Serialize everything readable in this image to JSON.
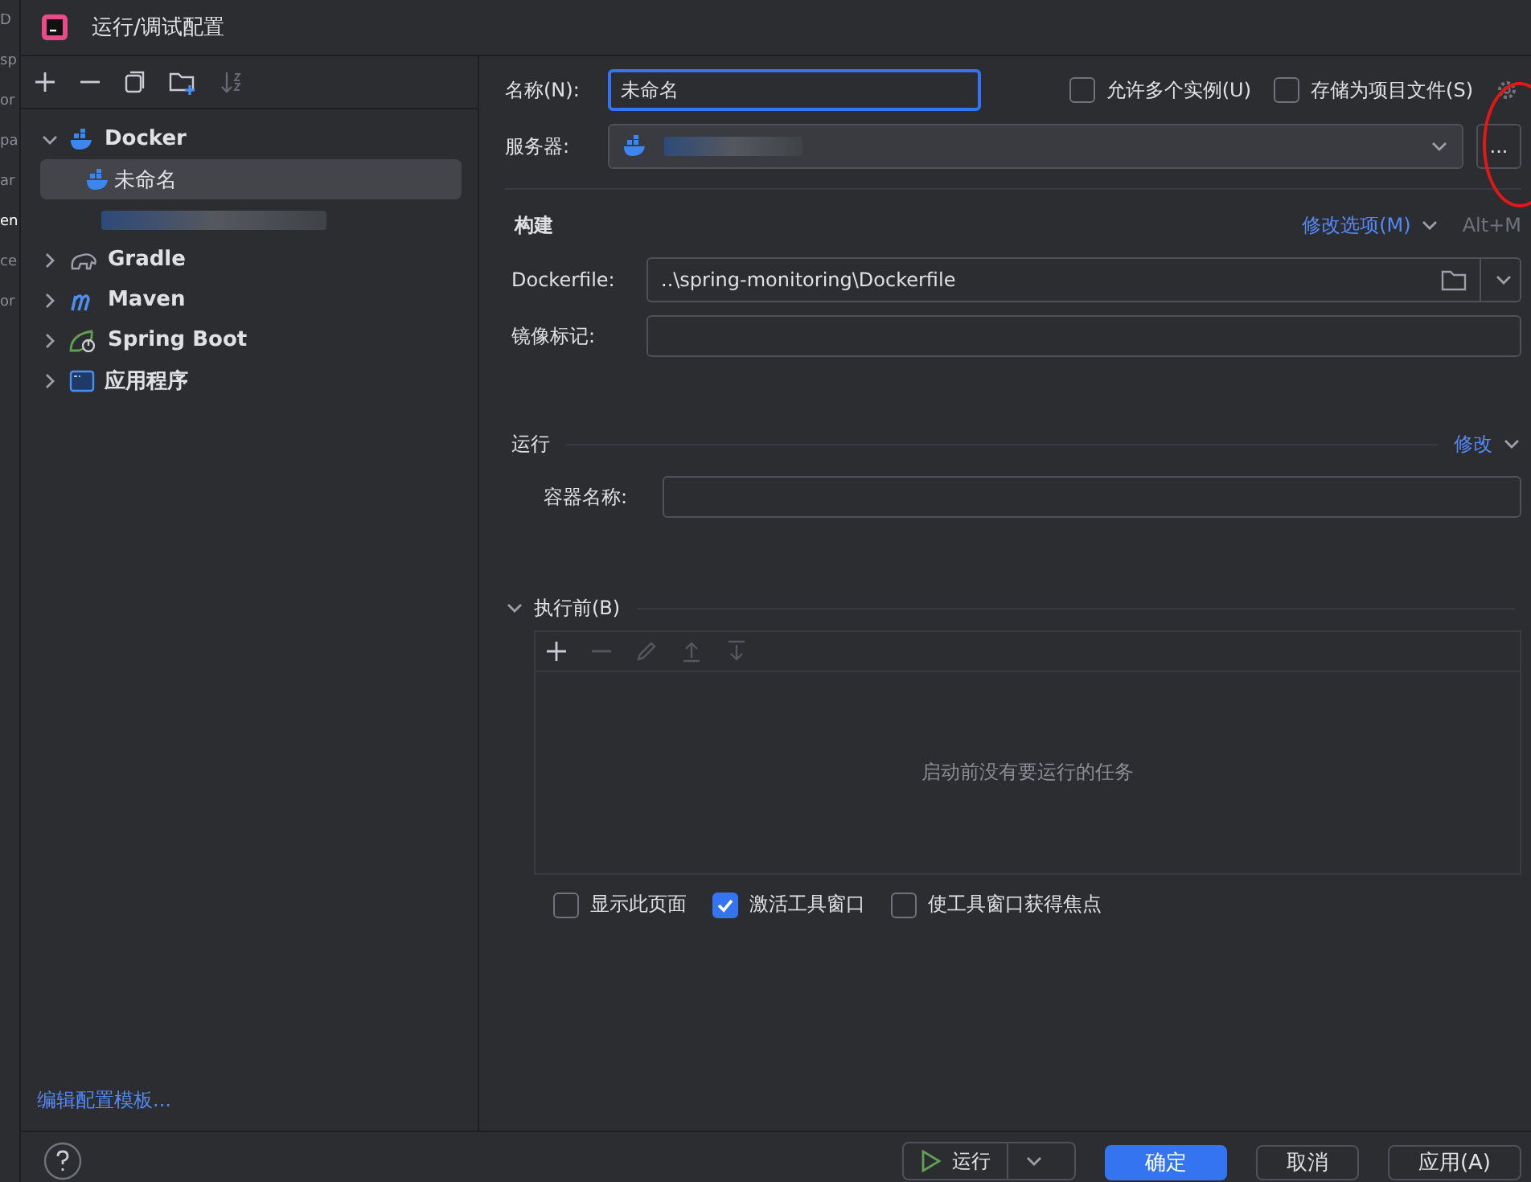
{
  "background_fragments": [
    "D",
    "sp",
    "or",
    "pa",
    "ar",
    "en",
    "ce",
    "or"
  ],
  "window": {
    "title": "运行/调试配置"
  },
  "tree": [
    {
      "label": "Docker",
      "kind": "docker",
      "expanded": true,
      "children": [
        {
          "label": "未命名",
          "kind": "docker",
          "selected": true
        },
        {
          "kind": "redacted",
          "selected": false
        }
      ]
    },
    {
      "label": "Gradle",
      "kind": "gradle",
      "expanded": false
    },
    {
      "label": "Maven",
      "kind": "maven",
      "expanded": false
    },
    {
      "label": "Spring Boot",
      "kind": "spring",
      "expanded": false
    },
    {
      "label": "应用程序",
      "kind": "app",
      "expanded": false
    }
  ],
  "edit_templates_link": "编辑配置模板...",
  "name_field": {
    "label": "名称(N):",
    "value": "未命名"
  },
  "options": [
    {
      "label": "允许多个实例(U)",
      "checked": false
    },
    {
      "label": "存储为项目文件(S)",
      "checked": false
    }
  ],
  "server": {
    "label": "服务器:",
    "more_button": "...",
    "annotation": {
      "kind": "circle"
    }
  },
  "build": {
    "title": "构建",
    "modify_link": "修改选项(M)",
    "shortcut": "Alt+M",
    "dockerfile": {
      "label": "Dockerfile:",
      "value": "..\\spring-monitoring\\Dockerfile"
    },
    "image_tag": {
      "label": "镜像标记:"
    }
  },
  "run": {
    "title": "运行",
    "modify_link": "修改",
    "container_name": {
      "label": "容器名称:"
    }
  },
  "before_launch": {
    "title": "执行前(B)",
    "expanded": true,
    "empty_text": "启动前没有要运行的任务"
  },
  "launch_options": [
    {
      "label": "显示此页面",
      "checked": false
    },
    {
      "label": "激活工具窗口",
      "checked": true
    },
    {
      "label": "使工具窗口获得焦点",
      "checked": false
    }
  ],
  "buttons": [
    {
      "label": "运行",
      "kind": "run"
    },
    {
      "label": "确定",
      "kind": "primary"
    },
    {
      "label": "取消",
      "kind": "plain"
    },
    {
      "label": "应用(A)",
      "kind": "plain"
    }
  ]
}
